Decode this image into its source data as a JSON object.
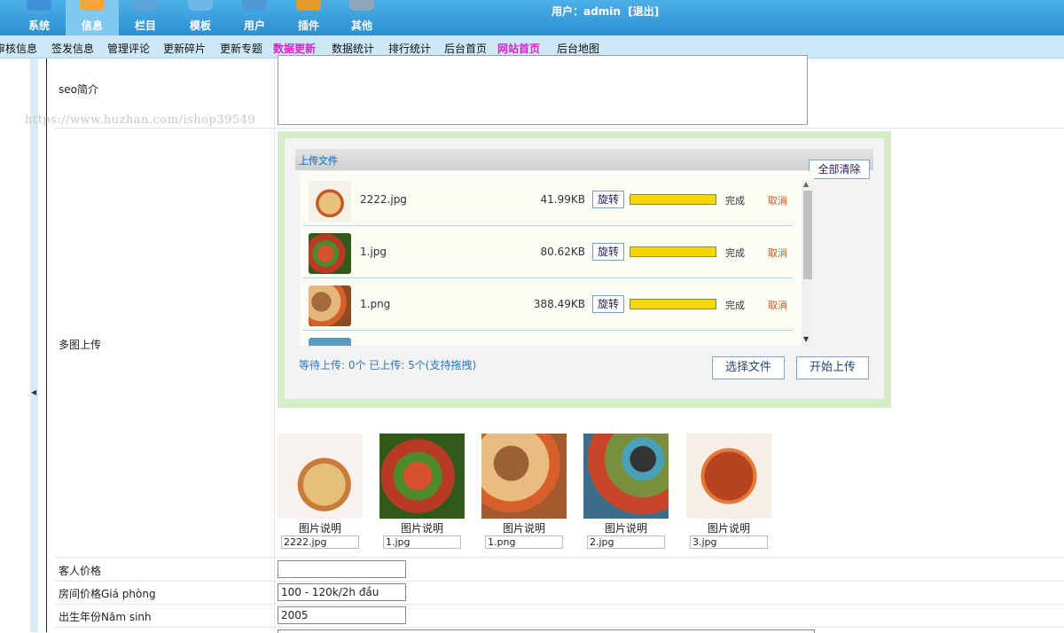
{
  "topnav": {
    "items": [
      {
        "label": "系统",
        "color": "#3e8fd8"
      },
      {
        "label": "信息",
        "color": "#f4a63a"
      },
      {
        "label": "栏目",
        "color": "#5fa4d9"
      },
      {
        "label": "模板",
        "color": "#6bb7e8"
      },
      {
        "label": "用户",
        "color": "#4d9ad6"
      },
      {
        "label": "插件",
        "color": "#e39a2b"
      },
      {
        "label": "其他",
        "color": "#8fa6bd"
      }
    ],
    "active_index": 1,
    "user_prefix": "用户：",
    "username": "admin",
    "logout": "[退出]"
  },
  "subnav": {
    "items": [
      {
        "label": "审核信息",
        "highlight": false
      },
      {
        "label": "签发信息",
        "highlight": false
      },
      {
        "label": "管理评论",
        "highlight": false
      },
      {
        "label": "更新碎片",
        "highlight": false
      },
      {
        "label": "更新专题",
        "highlight": false
      },
      {
        "label": "数据更新",
        "highlight": true
      },
      {
        "label": "数据统计",
        "highlight": false
      },
      {
        "label": "排行统计",
        "highlight": false
      },
      {
        "label": "后台首页",
        "highlight": false
      },
      {
        "label": "网站首页",
        "highlight": true
      },
      {
        "label": "后台地图",
        "highlight": false
      }
    ]
  },
  "form": {
    "seo_label": "seo简介",
    "seo_value": "",
    "multi_upload_label": "多图上传",
    "guest_price_label": "客人价格",
    "guest_price_value": "",
    "room_price_label": "房间价格Giá phòng",
    "room_price_value": "100 - 120k/2h đầu",
    "birth_year_label": "出生年份Năm sinh",
    "birth_year_value": "2005"
  },
  "watermark": "https://www.huzhan.com/ishop39549",
  "uploader": {
    "title": "上传文件",
    "clear_all": "全部清除",
    "files": [
      {
        "name": "2222.jpg",
        "size": "41.99KB",
        "rotate": "旋转",
        "progress": 1.0,
        "status": "完成",
        "cancel": "取消",
        "thumb_color": "#d9a35c"
      },
      {
        "name": "1.jpg",
        "size": "80.62KB",
        "rotate": "旋转",
        "progress": 1.0,
        "status": "完成",
        "cancel": "取消",
        "thumb_color": "#c2452d"
      },
      {
        "name": "1.png",
        "size": "388.49KB",
        "rotate": "旋转",
        "progress": 1.0,
        "status": "完成",
        "cancel": "取消",
        "thumb_color": "#b46a3a"
      }
    ],
    "status": "等待上传: 0个 已上传: 5个(支持拖拽)",
    "select_files": "选择文件",
    "start_upload": "开始上传"
  },
  "gallery": [
    {
      "caption": "图片说明",
      "filename": "2222.jpg",
      "color": "#d9a35c"
    },
    {
      "caption": "图片说明",
      "filename": "1.jpg",
      "color": "#c2452d"
    },
    {
      "caption": "图片说明",
      "filename": "1.png",
      "color": "#c07a3a"
    },
    {
      "caption": "图片说明",
      "filename": "2.jpg",
      "color": "#7a8f3c"
    },
    {
      "caption": "图片说明",
      "filename": "3.jpg",
      "color": "#b8431f"
    }
  ]
}
